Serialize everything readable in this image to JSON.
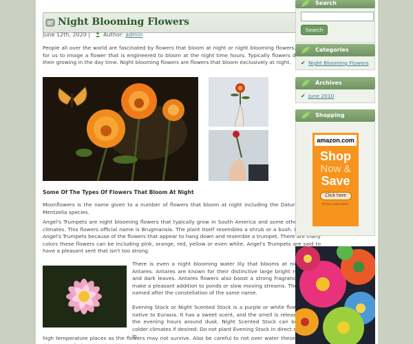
{
  "post": {
    "title": "Night Blooming Flowers",
    "date": "June 12th, 2020",
    "separator": "|",
    "author_prefix": "Author:",
    "author": "admin",
    "intro": "People all over the world are fascinated by flowers that bloom at night or night blooming flowers. It is hard for us to image a flower that is engineered to bloom at the night time hours. Typically flowers do most of their growing in the day time. Night blooming flowers are flowers that bloom exclusively at night.",
    "section_heading": "Some Of The Types Of Flowers That Bloom At Night",
    "p_moonflowers": "Moonflowers is the name given to a number of flowers that bloom at night including the Datura and the Mentzelia species.",
    "p_angels": "Angel's Trumpets are night blooming flowers that typically grow in South America and some other warmer climates. This flowers official name is Brugmansia. The plant itself resembles a shrub or a bush. It is called Angel's Trumpets because of the flowers that appear to hang down and resemble a trumpet. There are many colors these flowers can be including pink, orange, red, yellow or even white. Angel's Trumpets are said to have a pleasant sent that isn't too strong.",
    "p_waterlily": "There is even a night blooming water lily that blooms at night called Antares. Antares are known for their distinctive large bright red flower, and dark leaves. Antares flowers also boost a strong fragrance so they make a pleasant addition to ponds or slow moving streams. The flower is named after the constellation of the same name.",
    "p_stock": "Evening Stock or Night Scented Stock is a purple or white flower that is native to Eurasia. It has a sweet scent, and the smell is released during the evening hours around dusk. Night Scented Stock can be grow in colder climates if desired. Do not plant Evening Stock in direct sunlight or in",
    "p_stock_end": "high temperature places as the flowers may not survive. Also be careful to not over water these plants as this can easily happen with this species."
  },
  "sidebar": {
    "search": {
      "title": "Search",
      "button": "Search",
      "placeholder": ""
    },
    "categories": {
      "title": "Categories",
      "items": [
        "Night Blooming Flowers"
      ]
    },
    "archives": {
      "title": "Archives",
      "items": [
        "June 2010"
      ]
    },
    "shopping": {
      "title": "Shopping",
      "ad": {
        "brand": "amazon.com",
        "line1": "Shop",
        "line2": "Now &",
        "line3": "Save",
        "button": "Click here",
        "fine_print": "Privacy Information"
      }
    }
  },
  "colors": {
    "accent_green": "#6f9462",
    "link": "#3e7c8e",
    "amazon_orange": "#f7941e"
  }
}
